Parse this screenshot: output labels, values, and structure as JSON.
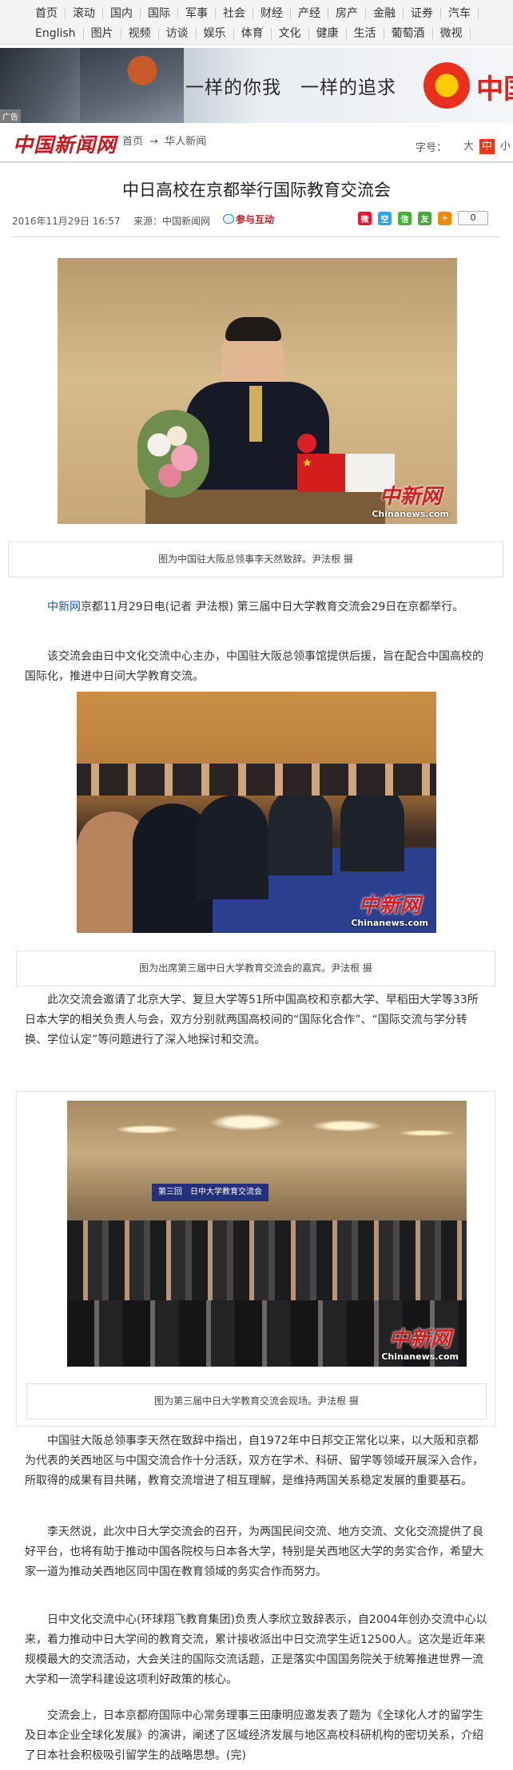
{
  "topnav": {
    "row1": [
      "首页",
      "滚动",
      "国内",
      "国际",
      "军事",
      "社会",
      "财经",
      "产经",
      "房产",
      "金融",
      "证券",
      "汽车"
    ],
    "row2": [
      "English",
      "图片",
      "视频",
      "访谈",
      "娱乐",
      "体育",
      "文化",
      "健康",
      "生活",
      "葡萄酒",
      "微视"
    ]
  },
  "banner": {
    "slogan": "一样的你我　一样的追求",
    "brand": "中国",
    "ad_label": "广告"
  },
  "header": {
    "logo": "中国新闻网",
    "breadcrumb": [
      "首页",
      "华人新闻"
    ],
    "breadcrumb_sep": "→",
    "fontsize_label": "字号：",
    "fontsize_options": [
      "大",
      "中",
      "小"
    ],
    "fontsize_selected": "中"
  },
  "article": {
    "title": "中日高校在京都举行国际教育交流会",
    "pubtime": "2016年11月29日 16:57",
    "source": "来源：中国新闻网",
    "interact": "参与互动",
    "share_count": "0",
    "watermark_cn": "中新网",
    "watermark_en": "Chinanews.com",
    "captions": [
      "图为中国驻大阪总领事李天然致辞。尹法根 摄",
      "图为出席第三届中日大学教育交流会的嘉宾。尹法根 摄",
      "图为第三届中日大学教育交流会现场。尹法根 摄"
    ],
    "stage_banner": "第三回　日中大学教育交流会",
    "paragraphs": {
      "p1_link": "中新网",
      "p1_text": "京都11月29日电(记者 尹法根) 第三届中日大学教育交流会29日在京都举行。",
      "p2": "该交流会由日中文化交流中心主办，中国驻大阪总领事馆提供后援，旨在配合中国高校的国际化，推进中日间大学教育交流。",
      "p3": "此次交流会邀请了北京大学、复旦大学等51所中国高校和京都大学、早稻田大学等33所日本大学的相关负责人与会，双方分别就两国高校间的“国际化合作”、“国际交流与学分转换、学位认定”等问题进行了深入地探讨和交流。",
      "p4": "中国驻大阪总领事李天然在致辞中指出，自1972年中日邦交正常化以来，以大阪和京都为代表的关西地区与中国交流合作十分活跃，双方在学术、科研、留学等领域开展深入合作，所取得的成果有目共睹，教育交流增进了相互理解，是维持两国关系稳定发展的重要基石。",
      "p5": "李天然说，此次中日大学交流会的召开，为两国民间交流、地方交流、文化交流提供了良好平台，也将有助于推动中国各院校与日本各大学，特别是关西地区大学的务实合作，希望大家一道为推动关西地区同中国在教育领域的务实合作而努力。",
      "p6": "日中文化交流中心(环球翔飞教育集团)负责人李欣立致辞表示，自2004年创办交流中心以来，着力推动中日大学间的教育交流，累计接收派出中日交流学生近12500人。这次是近年来规模最大的交流活动，大会关注的国际交流话题，正是落实中国国务院关于统筹推进世界一流大学和一流学科建设这项利好政策的核心。",
      "p7": "交流会上，日本京都府国际中心常务理事三田康明应邀发表了题为《全球化人才的留学生及日本企业全球化发展》的演讲，阐述了区域经济发展与地区高校科研机构的密切关系，介绍了日本社会积极吸引留学生的战略思想。(完)"
    }
  },
  "colors": {
    "brand_red": "#c8161d",
    "link_blue": "#1a55a8",
    "active_fontsize": "#e8391d"
  }
}
